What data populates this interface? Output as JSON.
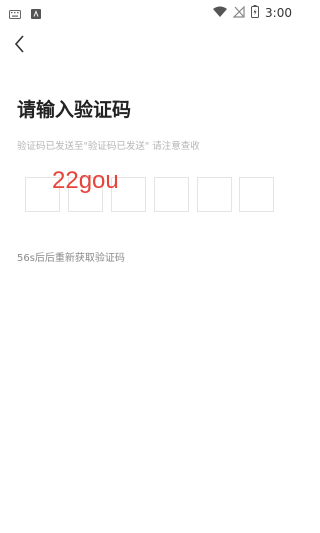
{
  "status_bar": {
    "time": "3:00",
    "left_icons": [
      "keyboard-icon",
      "app-notification-icon"
    ],
    "right_icons": [
      "wifi-icon",
      "no-signal-icon",
      "battery-icon"
    ]
  },
  "header": {
    "back_icon": "chevron-left-icon"
  },
  "page": {
    "title": "请输入验证码",
    "subtitle": "验证码已发送至\"验证码已发送\" 请注意查收",
    "code_input_value": "22gou",
    "code_box_count": 6,
    "resend_text": "56s后后重新获取验证码"
  },
  "colors": {
    "code_text": "#e8433b",
    "box_border": "#e4e4e4",
    "subtitle": "#b5b5b5"
  }
}
